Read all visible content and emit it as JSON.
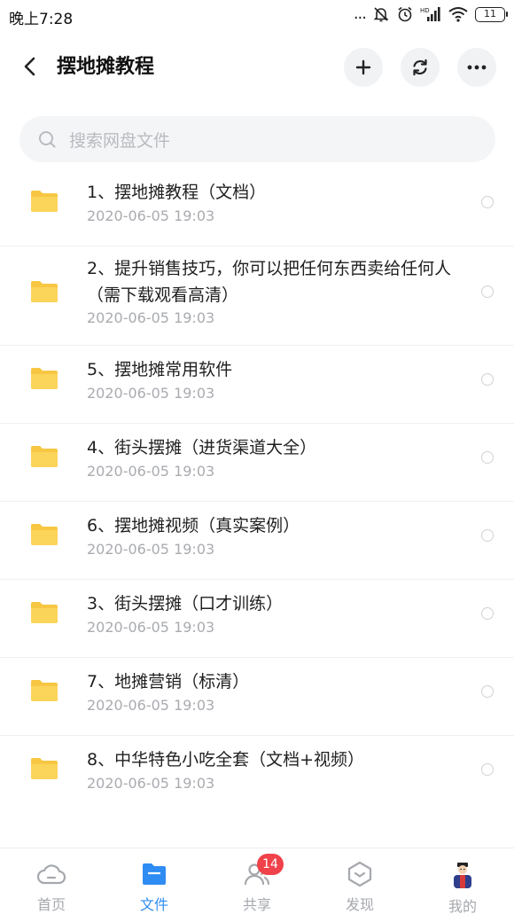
{
  "status_bar": {
    "time": "晚上7:28",
    "battery": "11",
    "dots": "..."
  },
  "header": {
    "title": "摆地摊教程",
    "icons": [
      "back-arrow",
      "add",
      "refresh",
      "more"
    ]
  },
  "search": {
    "placeholder": "搜索网盘文件"
  },
  "files": [
    {
      "name": "1、摆地摊教程（文档）",
      "date": "2020-06-05  19:03"
    },
    {
      "name": "2、提升销售技巧，你可以把任何东西卖给任何人（需下载观看高清）",
      "date": "2020-06-05  19:03"
    },
    {
      "name": "5、摆地摊常用软件",
      "date": "2020-06-05  19:03"
    },
    {
      "name": "4、街头摆摊（进货渠道大全）",
      "date": "2020-06-05  19:03"
    },
    {
      "name": "6、摆地摊视频（真实案例）",
      "date": "2020-06-05  19:03"
    },
    {
      "name": "3、街头摆摊（口才训练）",
      "date": "2020-06-05  19:03"
    },
    {
      "name": "7、地摊营销（标清）",
      "date": "2020-06-05  19:03"
    },
    {
      "name": "8、中华特色小吃全套（文档+视频）",
      "date": "2020-06-05  19:03"
    }
  ],
  "tabbar": {
    "tabs": [
      {
        "label": "首页",
        "icon": "cloud-icon",
        "active": false
      },
      {
        "label": "文件",
        "icon": "folder-icon",
        "active": true
      },
      {
        "label": "共享",
        "icon": "people-icon",
        "active": false,
        "badge": "14"
      },
      {
        "label": "发现",
        "icon": "discover-icon",
        "active": false
      },
      {
        "label": "我的",
        "icon": "avatar",
        "active": false
      }
    ]
  },
  "colors": {
    "accent": "#2f8cf3",
    "folder": "#f7c744",
    "badge": "#f0424a"
  }
}
